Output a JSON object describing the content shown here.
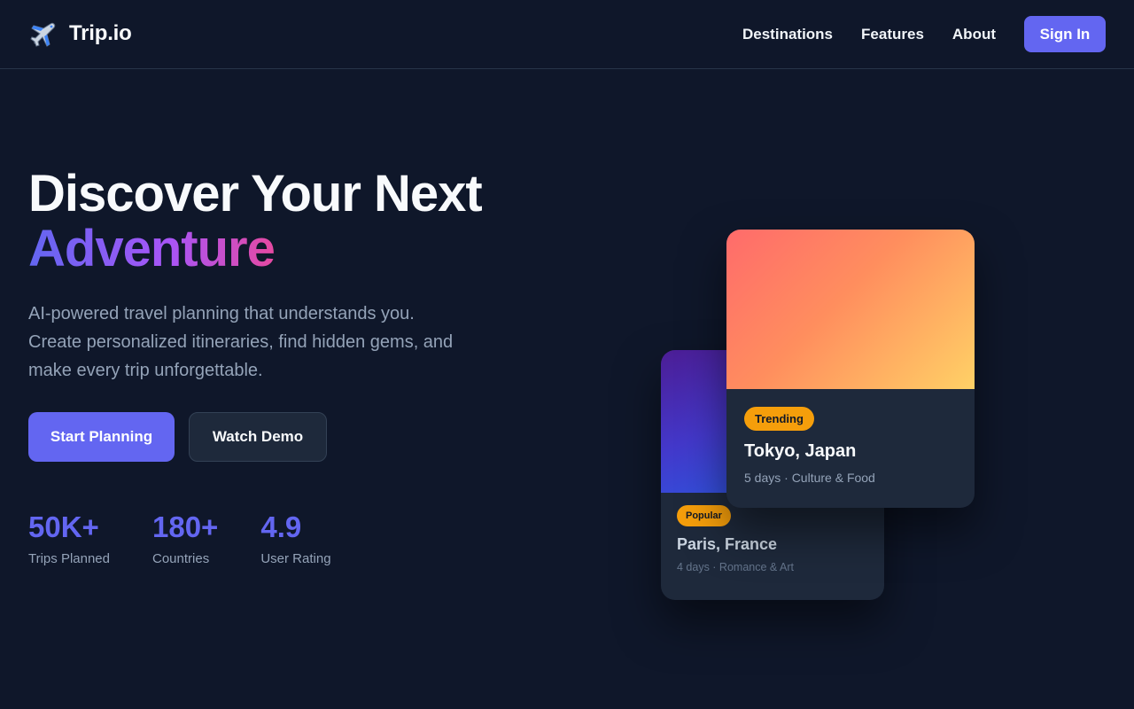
{
  "brand": {
    "name": "Trip.io",
    "icon": "airplane-icon"
  },
  "nav": {
    "links": [
      "Destinations",
      "Features",
      "About"
    ],
    "signin_label": "Sign In"
  },
  "hero": {
    "title_line1": "Discover Your Next",
    "title_line2": "Adventure",
    "subtitle": "AI-powered travel planning that understands you. Create personalized itineraries, find hidden gems, and make every trip unforgettable.",
    "primary_cta": "Start Planning",
    "secondary_cta": "Watch Demo"
  },
  "stats": [
    {
      "value": "50K+",
      "label": "Trips Planned"
    },
    {
      "value": "180+",
      "label": "Countries"
    },
    {
      "value": "4.9",
      "label": "User Rating"
    }
  ],
  "cards": {
    "front": {
      "badge": "Trending",
      "title": "Tokyo, Japan",
      "meta": "5 days · Culture & Food"
    },
    "back": {
      "badge": "Popular",
      "title": "Paris, France",
      "meta": "4 days · Romance & Art"
    }
  },
  "colors": {
    "background": "#0f172a",
    "accent": "#6366f1",
    "badge": "#f59e0b",
    "card": "#1e293b"
  }
}
